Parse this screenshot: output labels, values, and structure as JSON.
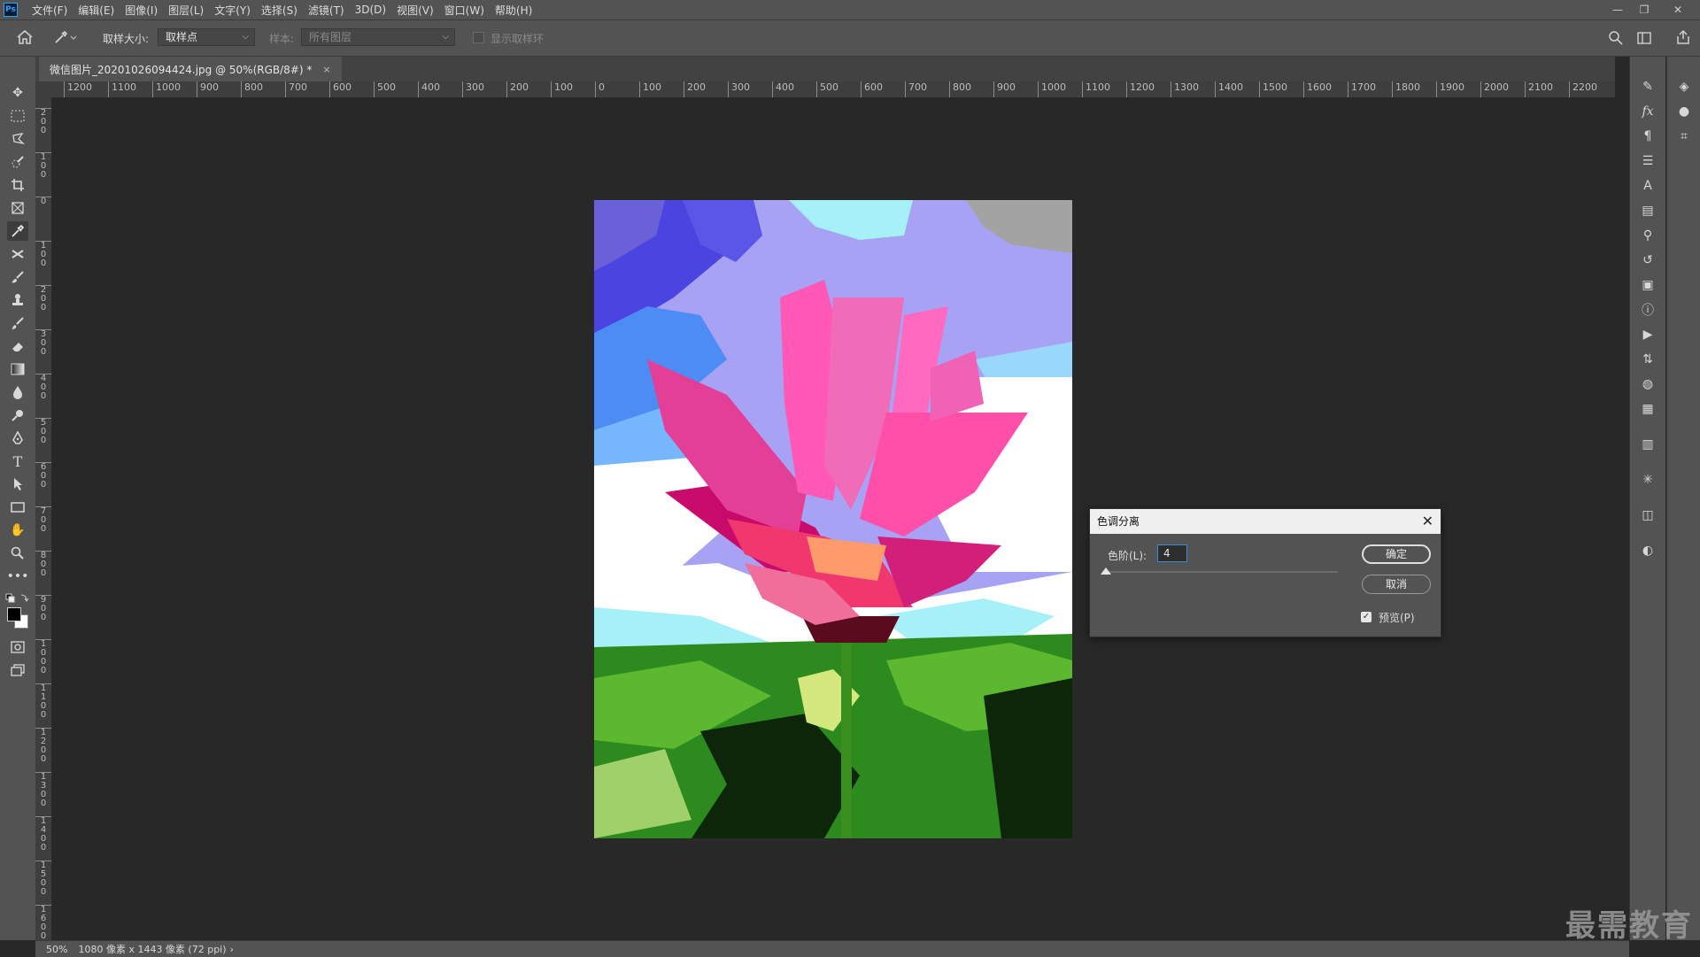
{
  "app": {
    "logo": "Ps"
  },
  "menus": [
    "文件(F)",
    "编辑(E)",
    "图像(I)",
    "图层(L)",
    "文字(Y)",
    "选择(S)",
    "滤镜(T)",
    "3D(D)",
    "视图(V)",
    "窗口(W)",
    "帮助(H)"
  ],
  "window_controls": {
    "minimize": "—",
    "restore": "❐",
    "close": "✕"
  },
  "options": {
    "sample_size_label": "取样大小:",
    "sample_size_value": "取样点",
    "sample_label": "样本:",
    "sample_value": "所有图层",
    "show_ring_label": "显示取样环"
  },
  "document_tab": {
    "title": "微信图片_20201026094424.jpg @ 50%(RGB/8#) *",
    "close": "×"
  },
  "ruler": {
    "h_labels": [
      "1200",
      "1100",
      "1000",
      "900",
      "800",
      "700",
      "600",
      "500",
      "400",
      "300",
      "200",
      "100",
      "0",
      "100",
      "200",
      "300",
      "400",
      "500",
      "600",
      "700",
      "800",
      "900",
      "1000",
      "1100",
      "1200",
      "1300",
      "1400",
      "1500",
      "1600",
      "1700",
      "1800",
      "1900",
      "2000",
      "2100",
      "2200"
    ],
    "v_labels": [
      "200",
      "100",
      "0",
      "100",
      "200",
      "300",
      "400",
      "500",
      "600",
      "700",
      "800",
      "900",
      "1000",
      "1100",
      "1200",
      "1300",
      "1400",
      "1500",
      "1600"
    ]
  },
  "status": {
    "zoom": "50%",
    "doc_info": "1080 像素 x 1443 像素 (72 ppi)",
    "arrow": "›"
  },
  "dialog": {
    "title": "色调分离",
    "levels_label": "色阶(L):",
    "levels_value": "4",
    "ok": "确定",
    "cancel": "取消",
    "preview_label": "预览(P)",
    "preview_checked": true,
    "slider_fraction": 0.0
  },
  "watermark": "最需教育",
  "colors": {
    "ui_bg": "#535353",
    "canvas_bg": "#282828",
    "accent": "#2fa3f7"
  }
}
